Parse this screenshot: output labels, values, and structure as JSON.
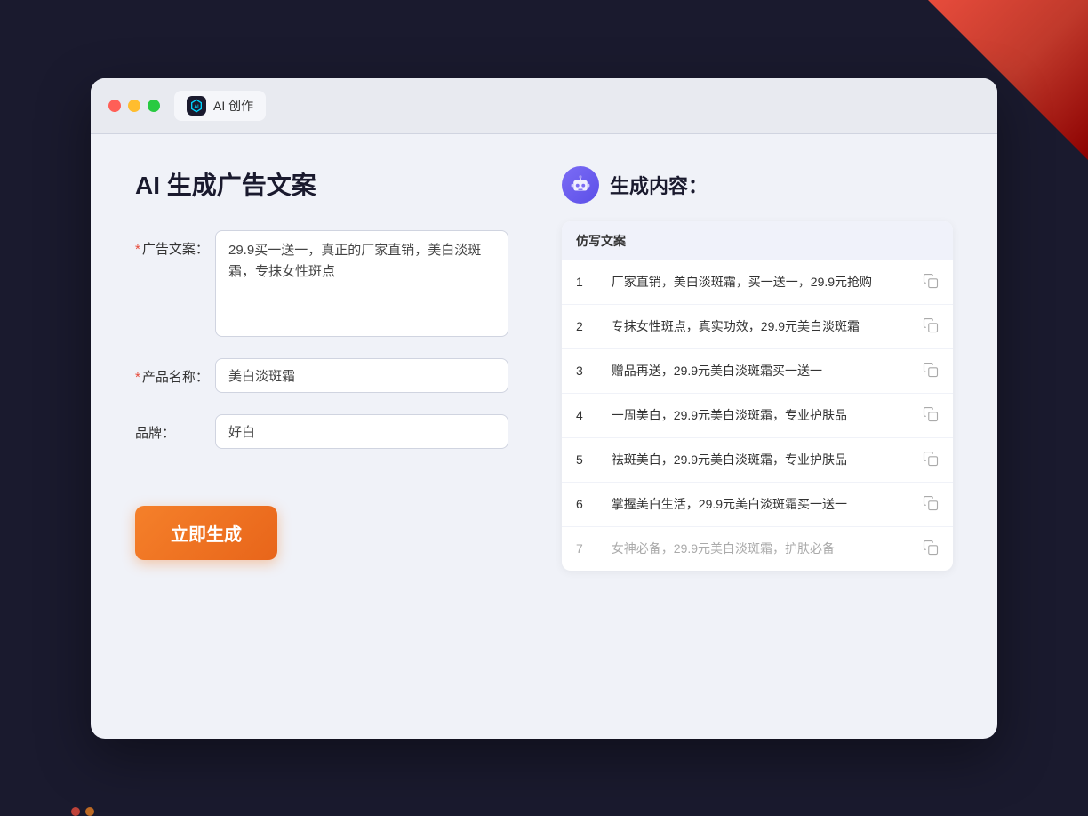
{
  "window": {
    "tab_label": "AI 创作",
    "controls": {
      "close": "close",
      "minimize": "minimize",
      "maximize": "maximize"
    }
  },
  "left_panel": {
    "title": "AI 生成广告文案",
    "form": {
      "ad_copy_label": "广告文案：",
      "ad_copy_required": "*",
      "ad_copy_value": "29.9买一送一，真正的厂家直销，美白淡斑霜，专抹女性斑点",
      "product_name_label": "产品名称：",
      "product_name_required": "*",
      "product_name_value": "美白淡斑霜",
      "brand_label": "品牌：",
      "brand_value": "好白"
    },
    "generate_button": "立即生成"
  },
  "right_panel": {
    "title": "生成内容：",
    "table_header": "仿写文案",
    "results": [
      {
        "id": 1,
        "text": "厂家直销，美白淡斑霜，买一送一，29.9元抢购"
      },
      {
        "id": 2,
        "text": "专抹女性斑点，真实功效，29.9元美白淡斑霜"
      },
      {
        "id": 3,
        "text": "赠品再送，29.9元美白淡斑霜买一送一"
      },
      {
        "id": 4,
        "text": "一周美白，29.9元美白淡斑霜，专业护肤品"
      },
      {
        "id": 5,
        "text": "祛斑美白，29.9元美白淡斑霜，专业护肤品"
      },
      {
        "id": 6,
        "text": "掌握美白生活，29.9元美白淡斑霜买一送一"
      },
      {
        "id": 7,
        "text": "女神必备，29.9元美白淡斑霜，护肤必备",
        "faded": true
      }
    ]
  },
  "icons": {
    "robot": "🤖",
    "copy": "📋",
    "ai_tab": "AI"
  }
}
